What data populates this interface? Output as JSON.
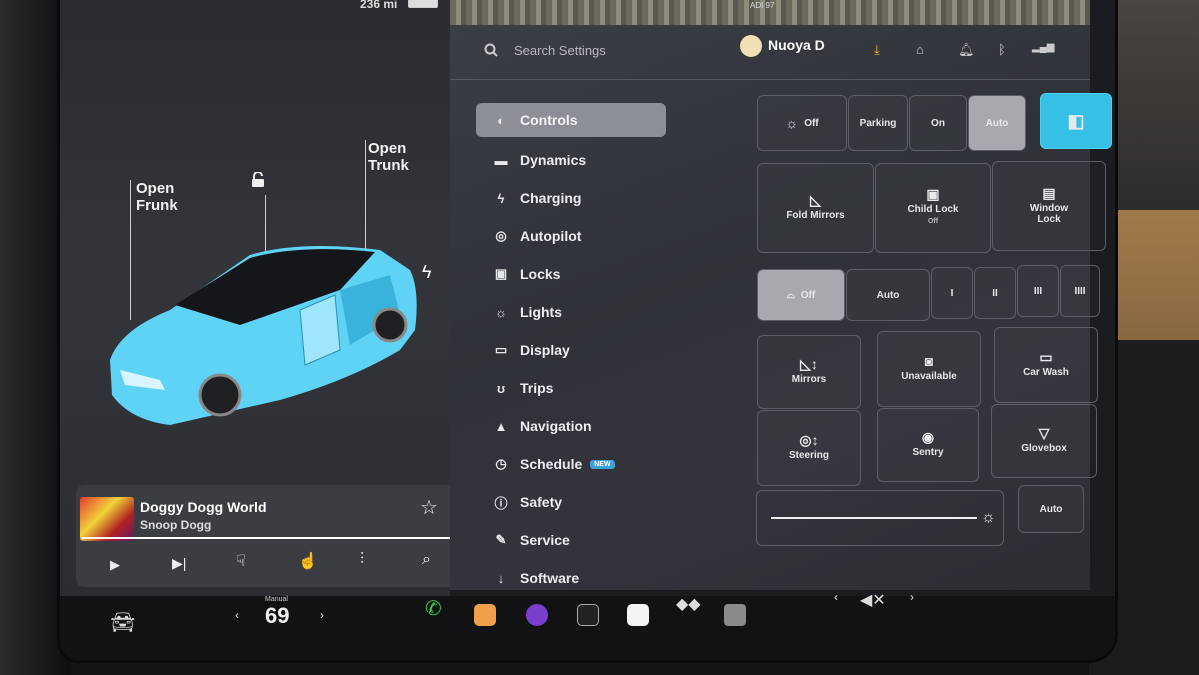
{
  "car": {
    "range": "236 mi",
    "frunk_label": "Open\nFrunk",
    "trunk_label": "Open\nTrunk"
  },
  "media": {
    "song": "Doggy Dogg World",
    "artist": "Snoop Dogg",
    "progress": 0.97
  },
  "settings": {
    "search_placeholder": "Search Settings",
    "profile_name": "Nuoya D",
    "map_label": "ADI 97",
    "nav_items": [
      {
        "label": "Controls",
        "icon": "toggle-icon",
        "glyph": "◐"
      },
      {
        "label": "Dynamics",
        "icon": "car-icon",
        "glyph": "▬"
      },
      {
        "label": "Charging",
        "icon": "bolt-icon",
        "glyph": "ϟ"
      },
      {
        "label": "Autopilot",
        "icon": "steering-wheel-icon",
        "glyph": "◎"
      },
      {
        "label": "Locks",
        "icon": "lock-icon",
        "glyph": "▣"
      },
      {
        "label": "Lights",
        "icon": "light-icon",
        "glyph": "☼"
      },
      {
        "label": "Display",
        "icon": "display-icon",
        "glyph": "▭"
      },
      {
        "label": "Trips",
        "icon": "trips-icon",
        "glyph": "ʊ"
      },
      {
        "label": "Navigation",
        "icon": "navigation-icon",
        "glyph": "▲"
      },
      {
        "label": "Schedule",
        "icon": "clock-icon",
        "glyph": "◷",
        "badge": "NEW"
      },
      {
        "label": "Safety",
        "icon": "safety-icon",
        "glyph": "ⓘ"
      },
      {
        "label": "Service",
        "icon": "wrench-icon",
        "glyph": "✎"
      },
      {
        "label": "Software",
        "icon": "download-icon",
        "glyph": "↓"
      }
    ],
    "headlights": {
      "off": "Off",
      "parking": "Parking",
      "on": "On",
      "auto": "Auto"
    },
    "tiles_row1": {
      "fold_mirrors": "Fold Mirrors",
      "child_lock": "Child Lock",
      "child_lock_state": "Off",
      "window_lock": "Window\nLock"
    },
    "wipers": {
      "off": "Off",
      "auto": "Auto",
      "speeds": [
        "I",
        "II",
        "III",
        "IIII"
      ]
    },
    "tiles_row2": {
      "mirrors": "Mirrors",
      "unavailable": "Unavailable",
      "car_wash": "Car Wash"
    },
    "tiles_row3": {
      "steering": "Steering",
      "sentry": "Sentry",
      "glovebox": "Glovebox"
    },
    "brightness_auto": "Auto"
  },
  "taskbar": {
    "temp_mode": "Manual",
    "temperature": "69"
  },
  "colors": {
    "accent": "#36c0e6",
    "car_body": "#5fd3f5"
  }
}
